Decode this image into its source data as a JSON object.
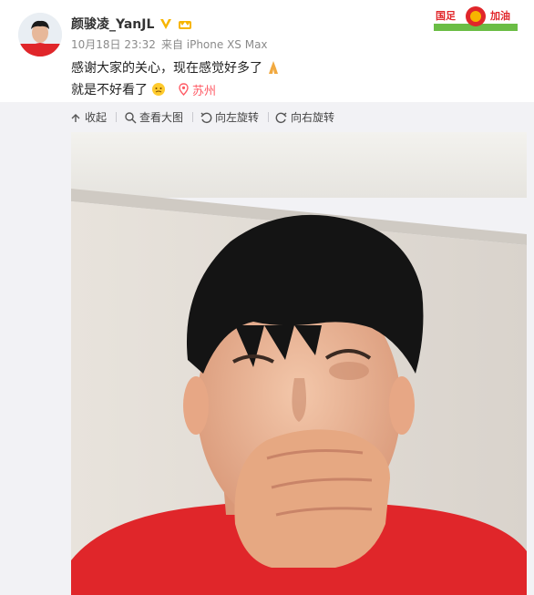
{
  "post": {
    "username": "颜骏凌_YanJL",
    "date": "10月18日 23:32",
    "source": "来自 iPhone XS Max",
    "text_line1": "感谢大家的关心，现在感觉好多了",
    "text_line2": "就是不好看了",
    "location": "苏州"
  },
  "badge": {
    "left_text": "国足",
    "right_text": "加油"
  },
  "toolbar": {
    "collapse": "收起",
    "view_large": "查看大图",
    "rotate_left": "向左旋转",
    "rotate_right": "向右旋转"
  },
  "colors": {
    "location": "#ff5a64",
    "toolbar_bg": "#f2f2f5",
    "jersey": "#e0262a"
  },
  "icons": [
    "verified-icon",
    "crown-icon",
    "pray-icon",
    "emoji-icon",
    "pin-icon",
    "collapse-icon",
    "zoom-icon",
    "rotate-left-icon",
    "rotate-right-icon"
  ]
}
